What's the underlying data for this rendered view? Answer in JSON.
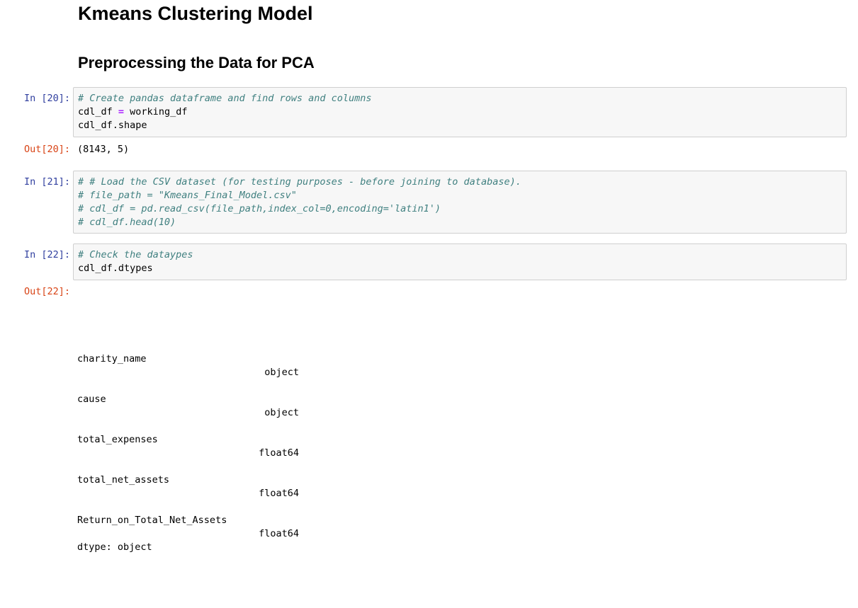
{
  "markdown": {
    "title": "Kmeans Clustering Model",
    "subtitle": "Preprocessing the Data for PCA"
  },
  "cells": {
    "c20": {
      "in_prompt": "In [20]:",
      "line1_comment": "# Create pandas dataframe and find rows and columns",
      "line2_a": "cdl_df ",
      "line2_op": "=",
      "line2_b": " working_df",
      "line3": "cdl_df.shape",
      "out_prompt": "Out[20]:",
      "output": "(8143, 5)"
    },
    "c21": {
      "in_prompt": "In [21]:",
      "lines": [
        "# # Load the CSV dataset (for testing purposes - before joining to database).",
        "# file_path = \"Kmeans_Final_Model.csv\"",
        "# cdl_df = pd.read_csv(file_path,index_col=0,encoding='latin1')",
        "# cdl_df.head(10)"
      ]
    },
    "c22": {
      "in_prompt": "In [22]:",
      "line1_comment": "# Check the dataypes",
      "line2": "cdl_df.dtypes",
      "out_prompt": "Out[22]:",
      "dtypes": [
        {
          "name": "charity_name",
          "type": "object"
        },
        {
          "name": "cause",
          "type": "object"
        },
        {
          "name": "total_expenses",
          "type": "float64"
        },
        {
          "name": "total_net_assets",
          "type": "float64"
        },
        {
          "name": "Return_on_Total_Net_Assets",
          "type": "float64"
        }
      ],
      "dtype_footer": "dtype: object"
    }
  }
}
